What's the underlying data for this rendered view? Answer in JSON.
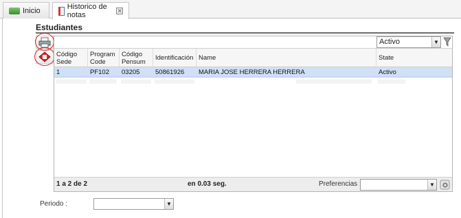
{
  "tabs": {
    "inicio": {
      "label": "Inicio"
    },
    "historico": {
      "label": "Historico de notas",
      "close_glyph": "✕"
    }
  },
  "section": {
    "title": "Estudiantes"
  },
  "toolbar": {
    "filter_value": "Activo",
    "print_icon": "printer-icon",
    "export_icon": "export-icon",
    "funnel_icon": "funnel-icon"
  },
  "table": {
    "columns": [
      {
        "label": "Código\nSede"
      },
      {
        "label": "Program\nCode"
      },
      {
        "label": "Código\nPensum"
      },
      {
        "label": "Identificación"
      },
      {
        "label": "Name"
      },
      {
        "label": "State"
      }
    ],
    "rows": [
      [
        "1",
        "PF102",
        "03205",
        "50861926",
        "MARIA JOSE HERRERA HERRERA",
        "Activo"
      ]
    ]
  },
  "footer": {
    "pagination": "1 a 2 de 2",
    "timing": "en 0.03 seg.",
    "preferences_label": "Preferencias :",
    "preferences_value": ""
  },
  "periodo": {
    "label": "Periodo :",
    "value": ""
  },
  "colors": {
    "selected_row": "#cfe0f7",
    "highlight_circle": "#dd2222",
    "header_bg": "#f6f6f6"
  },
  "arrow_glyph": "▼"
}
